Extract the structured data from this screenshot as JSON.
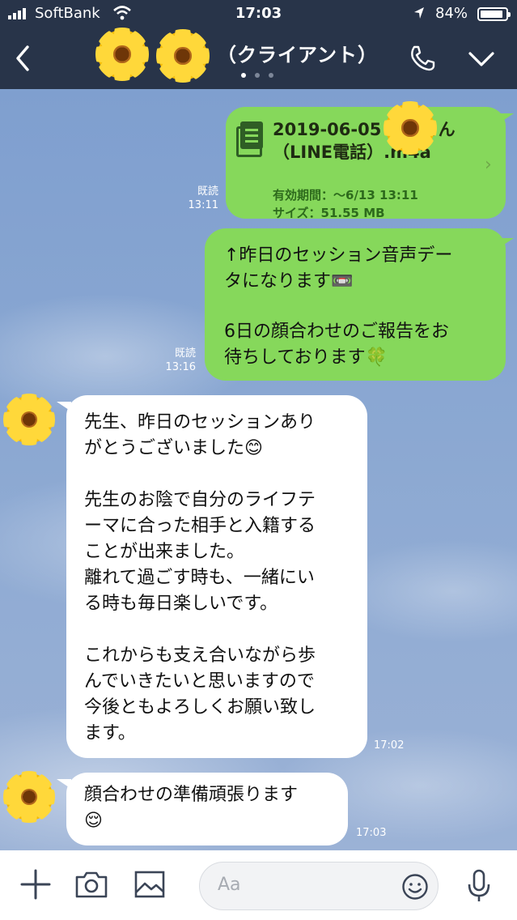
{
  "status": {
    "carrier": "SoftBank",
    "time": "17:03",
    "battery": "84%"
  },
  "header": {
    "title": "（クライアント）"
  },
  "messages": [
    {
      "type": "file",
      "side": "right",
      "read": "既読",
      "time": "13:11",
      "file_name": "2019-06-05 　　さん（LINE電話）.m4a",
      "file_name_line1": "2019-06-05 　　さん",
      "file_name_line2": "（LINE電話）.m4a",
      "expiry": "有効期間：〜6/13 13:11",
      "size": "サイズ：51.55 MB"
    },
    {
      "type": "text",
      "side": "right",
      "read": "既読",
      "time": "13:16",
      "lines": [
        "↑昨日のセッション音声デー",
        "タになります📼",
        "",
        "6日の顔合わせのご報告をお",
        "待ちしております🍀"
      ]
    },
    {
      "type": "text",
      "side": "left",
      "time": "17:02",
      "lines": [
        "先生、昨日のセッションあり",
        "がとうございました😊",
        "",
        "先生のお陰で自分のライフテ",
        "ーマに合った相手と入籍する",
        "ことが出来ました。",
        "離れて過ごす時も、一緒にい",
        "る時も毎日楽しいです。",
        "",
        "これからも支え合いながら歩",
        "んでいきたいと思いますので",
        "今後ともよろしくお願い致し",
        "ます。"
      ]
    },
    {
      "type": "text",
      "side": "left",
      "time": "17:03",
      "lines": [
        "顔合わせの準備頑張ります",
        "😌"
      ]
    }
  ],
  "input": {
    "placeholder": "Aa"
  },
  "colors": {
    "header_bg": "#283449",
    "my_bubble": "#86d85b",
    "other_bubble": "#ffffff",
    "chat_bg": "#8ba8d2"
  },
  "icons": [
    "back-icon",
    "phone-icon",
    "chevron-down-icon",
    "plus-icon",
    "camera-icon",
    "image-icon",
    "emoji-icon",
    "mic-icon",
    "cassette-icon",
    "clover-icon",
    "smile-icon",
    "file-icon"
  ]
}
